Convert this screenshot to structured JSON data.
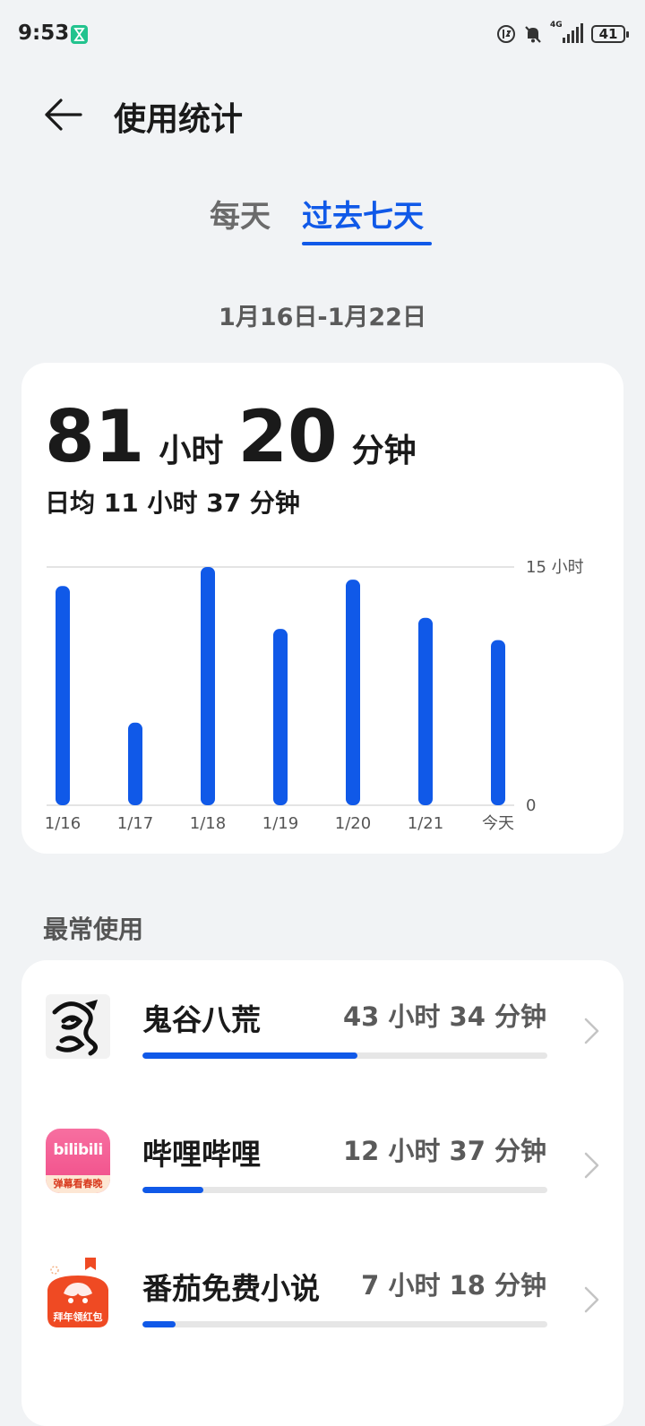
{
  "status_bar": {
    "time": "9:53",
    "network": "4G",
    "battery": "41"
  },
  "header": {
    "title": "使用统计"
  },
  "tabs": [
    {
      "label": "每天",
      "selected": false
    },
    {
      "label": "过去七天",
      "selected": true
    }
  ],
  "date_range": "1月16日-1月22日",
  "summary": {
    "total_hours": "81",
    "hours_unit": "小时",
    "total_minutes": "20",
    "minutes_unit": "分钟",
    "daily_average": "日均 11 小时 37 分钟"
  },
  "chart_data": {
    "type": "bar",
    "categories": [
      "1/16",
      "1/17",
      "1/18",
      "1/19",
      "1/20",
      "1/21",
      "今天"
    ],
    "values": [
      13.8,
      5.2,
      15.0,
      11.1,
      14.2,
      11.8,
      10.4
    ],
    "y_labels": [
      "15 小时",
      "0"
    ],
    "ylim": [
      0,
      15
    ],
    "color": "#1059e8"
  },
  "section": {
    "most_used": "最常使用"
  },
  "apps": [
    {
      "name": "鬼谷八荒",
      "time": "43 小时 34 分钟",
      "fraction": 0.531,
      "icon": "gui-gu-ba-huang-icon"
    },
    {
      "name": "哔哩哔哩",
      "time": "12 小时 37 分钟",
      "fraction": 0.151,
      "icon": "bilibili-icon",
      "icon_text": "bilibili",
      "icon_banner": "弹幕看春晚"
    },
    {
      "name": "番茄免费小说",
      "time": "7 小时 18 分钟",
      "fraction": 0.081,
      "icon": "fanqie-novel-icon",
      "icon_banner": "拜年领红包"
    }
  ],
  "colors": {
    "accent": "#1059e8",
    "background": "#f1f3f5",
    "card": "#ffffff"
  }
}
